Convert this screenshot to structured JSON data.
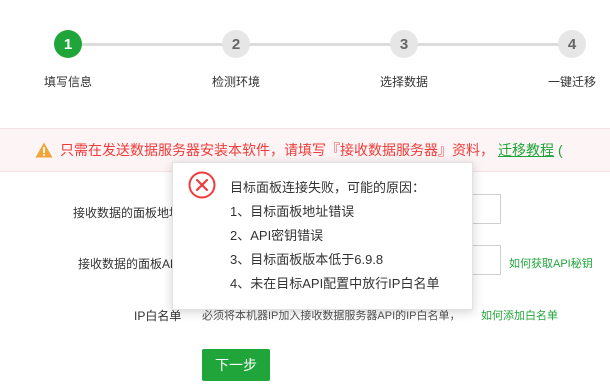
{
  "steps": [
    {
      "number": "1",
      "label": "填写信息"
    },
    {
      "number": "2",
      "label": "检测环境"
    },
    {
      "number": "3",
      "label": "选择数据"
    },
    {
      "number": "4",
      "label": "一键迁移"
    }
  ],
  "banner": {
    "text_before": "只需在发送数据服务器安装本软件，请填写『接收数据服务器』资料，",
    "link": "迁移教程",
    "tail": "("
  },
  "form": {
    "address_label": "接收数据的面板地址",
    "key_label": "接收数据的面板API秘钥",
    "key_link": "如何获取API秘钥",
    "ip_label": "IP白名单",
    "ip_hint": "必须将本机器IP加入接收数据服务器API的IP白名单，",
    "ip_link": "如何添加白名单",
    "next_button": "下一步"
  },
  "popup": {
    "title": "目标面板连接失败，可能的原因：",
    "reasons": [
      "1、目标面板地址错误",
      "2、API密钥错误",
      "3、目标面板版本低于6.9.8",
      "4、未在目标API配置中放行IP白名单"
    ]
  },
  "colors": {
    "accent": "#20a53a",
    "error": "#ef3b3b",
    "step_inactive": "#e6e6e6"
  }
}
